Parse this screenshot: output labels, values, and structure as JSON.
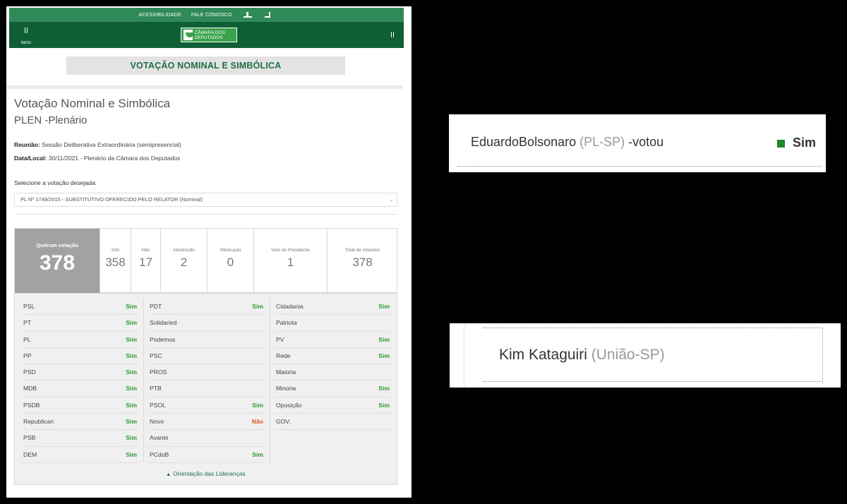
{
  "topbar": {
    "accessibility": "ACESSIBILIDADE",
    "contact": "FALE CONOSCO"
  },
  "header": {
    "menu_label": "MENU",
    "logo_text": "CÂMARA DOS DEPUTADOS"
  },
  "banner": {
    "title": "VOTAÇÃO NOMINAL E SIMBÓLICA"
  },
  "page": {
    "title": "Votação Nominal e Simbólica",
    "subtitle": "PLEN -Plenário",
    "meeting_label": "Reunião:",
    "meeting_value": "Sessão Deliberativa Extraordinária (semipresencial)",
    "date_label": "Data/Local:",
    "date_value": "30/11/2021 - Plenário da Câmara dos Deputados",
    "select_label": "Selecione a votação desejada:",
    "select_value": "PL Nº 1749/2015 - SUBSTITUTIVO OFERECIDO PELO RELATOR (Nominal)"
  },
  "stats": {
    "quorum_label": "Quórum votação",
    "quorum_value": "378",
    "items": [
      {
        "label": "Sim",
        "value": "358"
      },
      {
        "label": "Não",
        "value": "17"
      },
      {
        "label": "Abstenção",
        "value": "2"
      },
      {
        "label": "Obstrução",
        "value": "0"
      },
      {
        "label": "Voto do Presidente",
        "value": "1"
      },
      {
        "label": "Total de votantes",
        "value": "378"
      }
    ]
  },
  "parties": {
    "col1": [
      {
        "name": "PSL",
        "vote": "Sim"
      },
      {
        "name": "PT",
        "vote": "Sim"
      },
      {
        "name": "PL",
        "vote": "Sim"
      },
      {
        "name": "PP",
        "vote": "Sim"
      },
      {
        "name": "PSD",
        "vote": "Sim"
      },
      {
        "name": "MDB",
        "vote": "Sim"
      },
      {
        "name": "PSDB",
        "vote": "Sim"
      },
      {
        "name": "Republican",
        "vote": "Sim"
      },
      {
        "name": "PSB",
        "vote": "Sim"
      },
      {
        "name": "DEM",
        "vote": "Sim"
      }
    ],
    "col2": [
      {
        "name": "PDT",
        "vote": "Sim"
      },
      {
        "name": "Solidaried",
        "vote": ""
      },
      {
        "name": "Podemos",
        "vote": ""
      },
      {
        "name": "PSC",
        "vote": ""
      },
      {
        "name": "PROS",
        "vote": ""
      },
      {
        "name": "PTB",
        "vote": ""
      },
      {
        "name": "PSOL",
        "vote": "Sim"
      },
      {
        "name": "Novo",
        "vote": "Não"
      },
      {
        "name": "Avante",
        "vote": ""
      },
      {
        "name": "PCdoB",
        "vote": "Sim"
      }
    ],
    "col3": [
      {
        "name": "Cidadania",
        "vote": "Sim"
      },
      {
        "name": "Patriota",
        "vote": ""
      },
      {
        "name": "PV",
        "vote": "Sim"
      },
      {
        "name": "Rede",
        "vote": "Sim"
      },
      {
        "name": "Maioria",
        "vote": ""
      },
      {
        "name": "Minoria",
        "vote": "Sim"
      },
      {
        "name": "Oposição",
        "vote": "Sim"
      },
      {
        "name": "GOV.",
        "vote": ""
      }
    ],
    "orientation_link": "Orientação das Lideranças"
  },
  "snippet1": {
    "name": "EduardoBolsonaro",
    "party": "(PL-SP)",
    "suffix": " -votou",
    "vote": "Sim",
    "vote_color": "#1d8a2c"
  },
  "snippet2": {
    "name": "Kim Kataguiri",
    "party": "(União-SP)"
  },
  "colors": {
    "brand_green": "#0f5e36",
    "topbar_green": "#2f8a57",
    "sim_green": "#2c9a2c",
    "nao_orange": "#d9531e"
  }
}
